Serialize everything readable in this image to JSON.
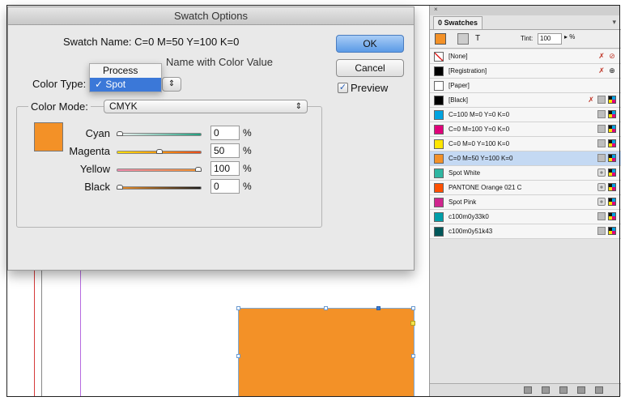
{
  "dialog": {
    "title": "Swatch Options",
    "swatch_name_label": "Swatch Name:",
    "swatch_name": "C=0 M=50 Y=100 K=0",
    "name_with_color_value": "Name with Color Value",
    "color_type_label": "Color Type:",
    "color_type_options": [
      "Process",
      "Spot"
    ],
    "color_type_selected": "Spot",
    "ok": "OK",
    "cancel": "Cancel",
    "preview": "Preview",
    "color_mode_label": "Color Mode:",
    "color_mode": "CMYK",
    "swatch_color": "#f39127",
    "sliders": [
      {
        "label": "Cyan",
        "value": "0",
        "unit": "%",
        "fraction": 0.0
      },
      {
        "label": "Magenta",
        "value": "50",
        "unit": "%",
        "fraction": 0.5
      },
      {
        "label": "Yellow",
        "value": "100",
        "unit": "%",
        "fraction": 1.0
      },
      {
        "label": "Black",
        "value": "0",
        "unit": "%",
        "fraction": 0.0
      }
    ]
  },
  "panel": {
    "tab": "0 Swatches",
    "close": "×",
    "tint_label": "Tint:",
    "tint_value": "100",
    "tint_unit": "▸ %",
    "swatches": [
      {
        "name": "[None]",
        "color": "none",
        "icons": [
          "x-icon",
          "none-icon"
        ]
      },
      {
        "name": "[Registration]",
        "color": "#000000",
        "icons": [
          "x-icon",
          "registration-icon"
        ]
      },
      {
        "name": "[Paper]",
        "color": "#ffffff",
        "icons": []
      },
      {
        "name": "[Black]",
        "color": "#000000",
        "icons": [
          "x-icon",
          "gray-icon",
          "cmyk-icon"
        ]
      },
      {
        "name": "C=100 M=0 Y=0 K=0",
        "color": "#00a3e0",
        "icons": [
          "gray-icon",
          "cmyk-icon"
        ]
      },
      {
        "name": "C=0 M=100 Y=0 K=0",
        "color": "#e0007a",
        "icons": [
          "gray-icon",
          "cmyk-icon"
        ]
      },
      {
        "name": "C=0 M=0 Y=100 K=0",
        "color": "#ffe600",
        "icons": [
          "gray-icon",
          "cmyk-icon"
        ]
      },
      {
        "name": "C=0 M=50 Y=100 K=0",
        "color": "#f39127",
        "icons": [
          "gray-icon",
          "cmyk-icon"
        ],
        "selected": true
      },
      {
        "name": "Spot White",
        "color": "#2fb6a2",
        "icons": [
          "spot-icon",
          "cmyk-icon"
        ]
      },
      {
        "name": "PANTONE Orange 021 C",
        "color": "#fe5000",
        "icons": [
          "spot-icon",
          "cmyk-icon"
        ]
      },
      {
        "name": "Spot Pink",
        "color": "#d0258e",
        "icons": [
          "spot-icon",
          "cmyk-icon"
        ]
      },
      {
        "name": "c100m0y33k0",
        "color": "#009ea8",
        "icons": [
          "gray-icon",
          "cmyk-icon"
        ]
      },
      {
        "name": "c100m0y51k43",
        "color": "#00575a",
        "icons": [
          "gray-icon",
          "cmyk-icon"
        ]
      }
    ]
  },
  "canvas": {
    "object_color": "#f39127"
  }
}
